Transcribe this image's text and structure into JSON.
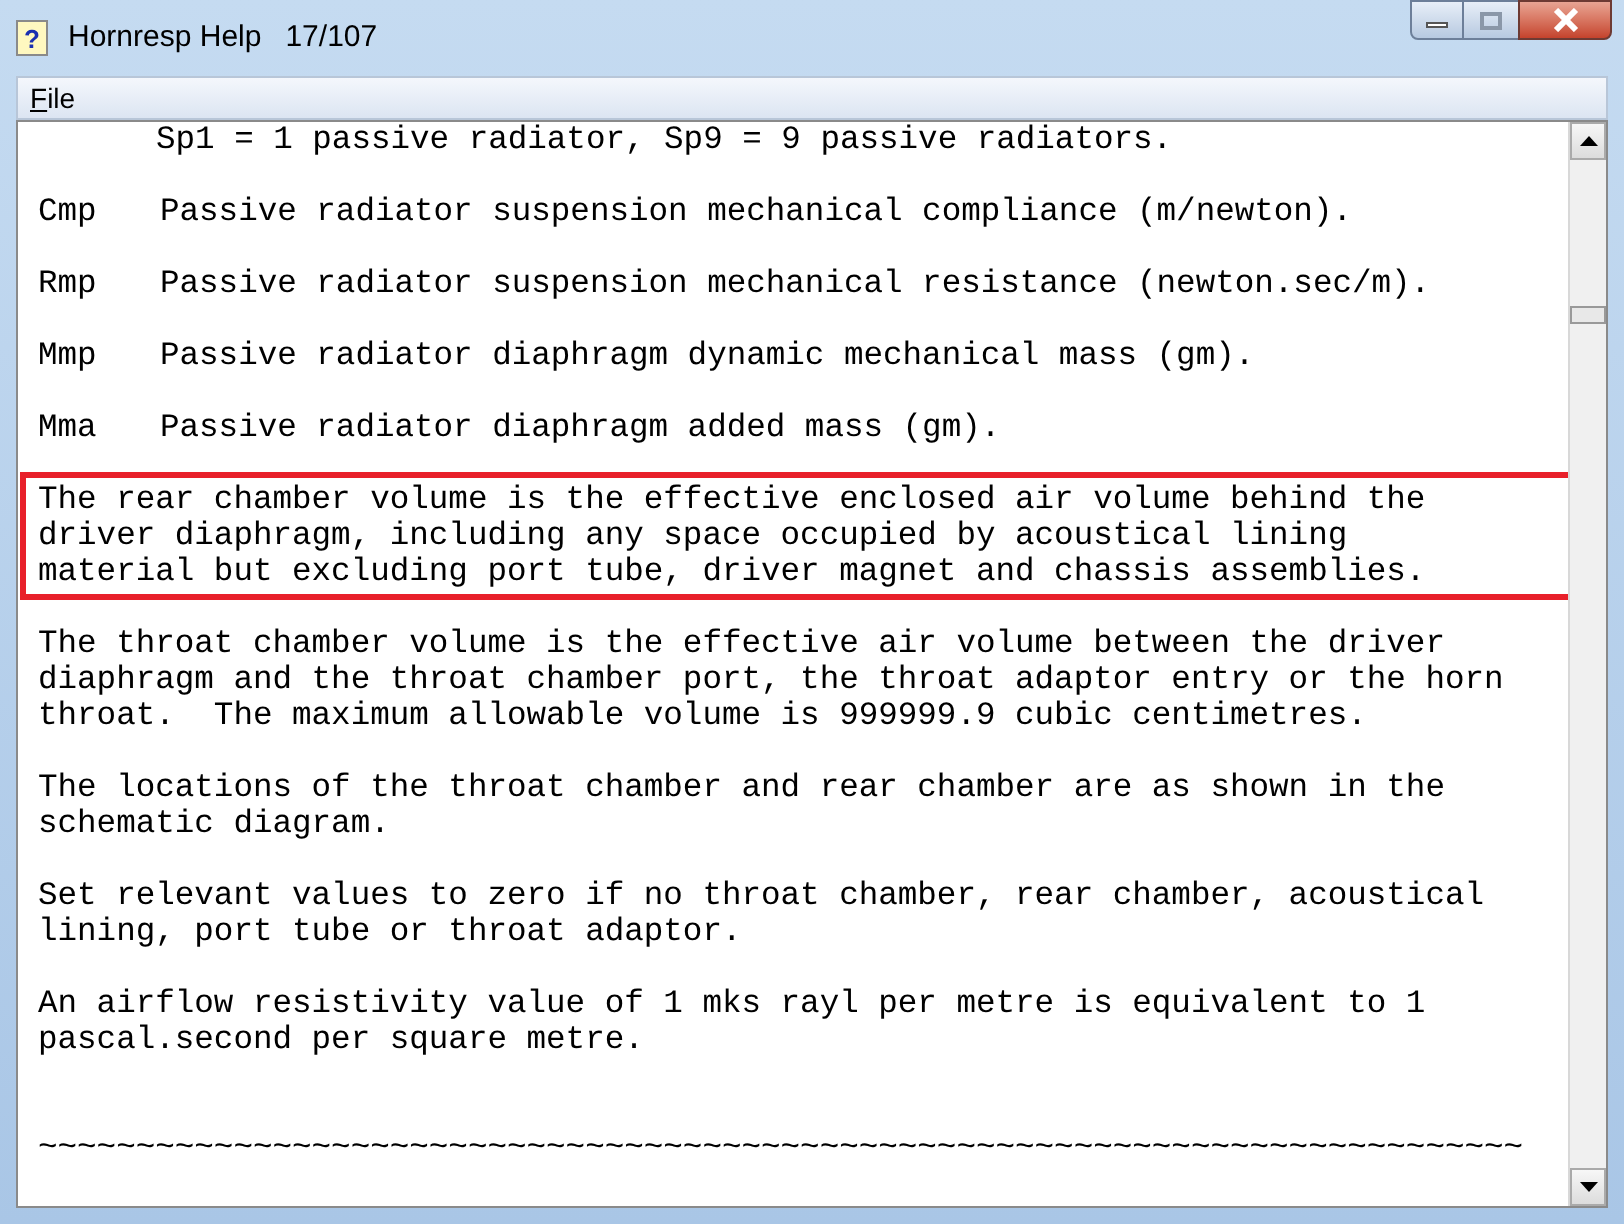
{
  "window": {
    "icon": "?",
    "title": "Hornresp Help",
    "page": "17/107"
  },
  "menu": [
    {
      "label": "File"
    }
  ],
  "blocks": [
    {
      "kind": "indented",
      "lines": [
        "Sp1 = 1 passive radiator, Sp9 = 9 passive radiators."
      ]
    },
    {
      "kind": "term",
      "term": "Cmp",
      "description": "Passive radiator suspension mechanical compliance (m/newton)."
    },
    {
      "kind": "term",
      "term": "Rmp",
      "description": "Passive radiator suspension mechanical resistance (newton.sec/m)."
    },
    {
      "kind": "term",
      "term": "Mmp",
      "description": "Passive radiator diaphragm dynamic mechanical mass (gm)."
    },
    {
      "kind": "term",
      "term": "Mma",
      "description": "Passive radiator diaphragm added mass (gm)."
    },
    {
      "kind": "paragraph",
      "highlighted": true,
      "lines": [
        "The rear chamber volume is the effective enclosed air volume behind the",
        "driver diaphragm, including any space occupied by acoustical lining",
        "material but excluding port tube, driver magnet and chassis assemblies."
      ]
    },
    {
      "kind": "paragraph",
      "highlighted": false,
      "lines": [
        "The throat chamber volume is the effective air volume between the driver",
        "diaphragm and the throat chamber port, the throat adaptor entry or the horn",
        "throat.  The maximum allowable volume is 999999.9 cubic centimetres."
      ]
    },
    {
      "kind": "paragraph",
      "highlighted": false,
      "lines": [
        "The locations of the throat chamber and rear chamber are as shown in the",
        "schematic diagram."
      ]
    },
    {
      "kind": "paragraph",
      "highlighted": false,
      "lines": [
        "Set relevant values to zero if no throat chamber, rear chamber, acoustical",
        "lining, port tube or throat adaptor."
      ]
    },
    {
      "kind": "paragraph",
      "highlighted": false,
      "lines": [
        "An airflow resistivity value of 1 mks rayl per metre is equivalent to 1",
        "pascal.second per square metre."
      ]
    },
    {
      "kind": "separator",
      "lines": [
        "~~~~~~~~~~~~~~~~~~~~~~~~~~~~~~~~~~~~~~~~~~~~~~~~~~~~~~~~~~~~~~~~~~~~~~~~~~~~"
      ]
    }
  ]
}
